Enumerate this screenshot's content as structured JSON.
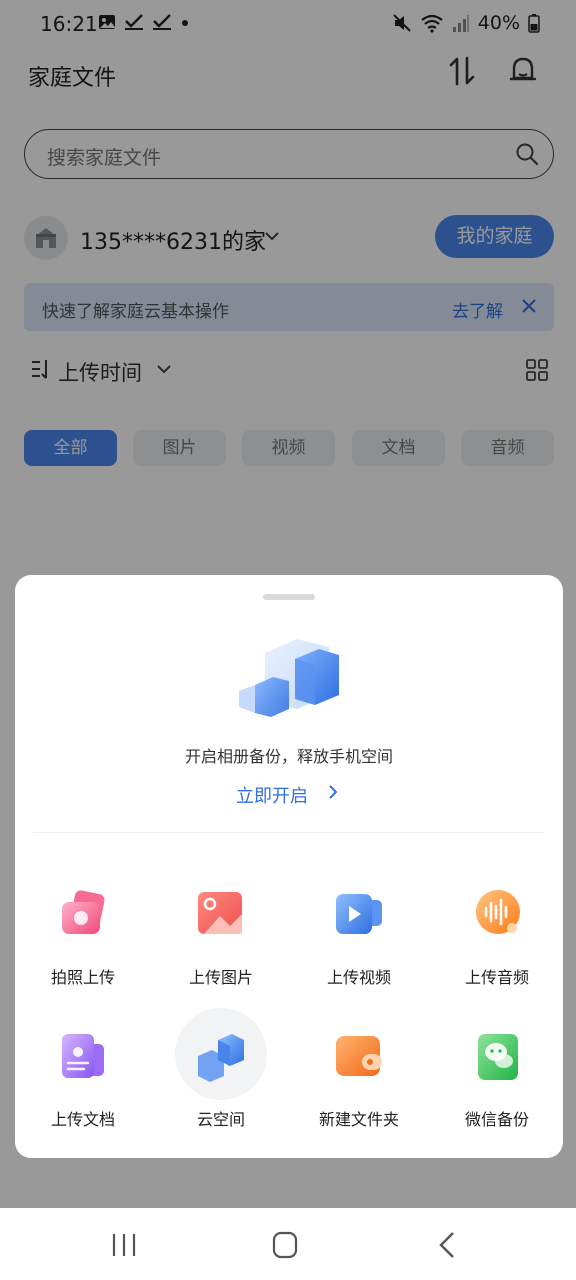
{
  "status_bar": {
    "time": "16:21",
    "left_icons": [
      "gallery-icon",
      "check-icon",
      "check-icon",
      "dot-icon"
    ],
    "right_icons": [
      "mute-icon",
      "wifi-icon",
      "signal-icon"
    ],
    "battery": "40%"
  },
  "header": {
    "title": "家庭文件",
    "transfer_icon": "transfer-icon",
    "notification_icon": "bell-icon"
  },
  "search": {
    "placeholder": "搜索家庭文件"
  },
  "family": {
    "name": "135****6231的家",
    "my_home_button": "我的家庭"
  },
  "tip": {
    "text": "快速了解家庭云基本操作",
    "link": "去了解"
  },
  "sort": {
    "label": "上传时间"
  },
  "filters": [
    {
      "label": "全部",
      "active": true
    },
    {
      "label": "图片",
      "active": false
    },
    {
      "label": "视频",
      "active": false
    },
    {
      "label": "文档",
      "active": false
    },
    {
      "label": "音频",
      "active": false
    }
  ],
  "sheet": {
    "backup_text": "开启相册备份，释放手机空间",
    "backup_cta": "立即开启",
    "actions": [
      {
        "label": "拍照上传",
        "icon": "camera-upload-icon"
      },
      {
        "label": "上传图片",
        "icon": "image-upload-icon"
      },
      {
        "label": "上传视频",
        "icon": "video-upload-icon"
      },
      {
        "label": "上传音频",
        "icon": "audio-upload-icon"
      },
      {
        "label": "上传文档",
        "icon": "document-upload-icon"
      },
      {
        "label": "云空间",
        "icon": "cloud-space-icon"
      },
      {
        "label": "新建文件夹",
        "icon": "new-folder-icon"
      },
      {
        "label": "微信备份",
        "icon": "wechat-backup-icon"
      }
    ]
  },
  "nav_bar": [
    "recent-apps-icon",
    "home-icon",
    "back-icon"
  ],
  "colors": {
    "accent": "#4c86ee",
    "link": "#2f6fe0",
    "tip_bg": "#dde8fb"
  }
}
